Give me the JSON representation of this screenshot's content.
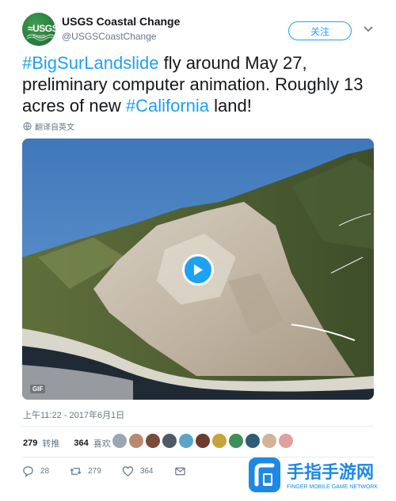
{
  "account": {
    "name": "USGS Coastal Change",
    "handle": "@USGSCoastChange",
    "avatar_text": "≈USGS",
    "avatar_sub": "Coasts"
  },
  "follow_button": {
    "label": "关注"
  },
  "tweet": {
    "hashtag1": "#BigSurLandslide",
    "text1": " fly around May 27, preliminary computer animation. Roughly 13 acres of new ",
    "hashtag2": "#California",
    "text2": " land!"
  },
  "translate": {
    "label": "翻译自英文"
  },
  "media": {
    "gif_badge": "GIF"
  },
  "timestamp": "上午11:22 - 2017年6月1日",
  "stats": {
    "retweets_count": "279",
    "retweets_label": "转推",
    "likes_count": "364",
    "likes_label": "喜欢"
  },
  "actions": {
    "reply_count": "28",
    "retweet_count": "279",
    "like_count": "364"
  },
  "watermark": {
    "title": "手指手游网",
    "subtitle": "FINGER MOBILE GAME NETWORK"
  },
  "colors": {
    "accent": "#1da1f2",
    "text": "#14171a",
    "secondary": "#657786",
    "brand_green": "#2c7d3f"
  }
}
